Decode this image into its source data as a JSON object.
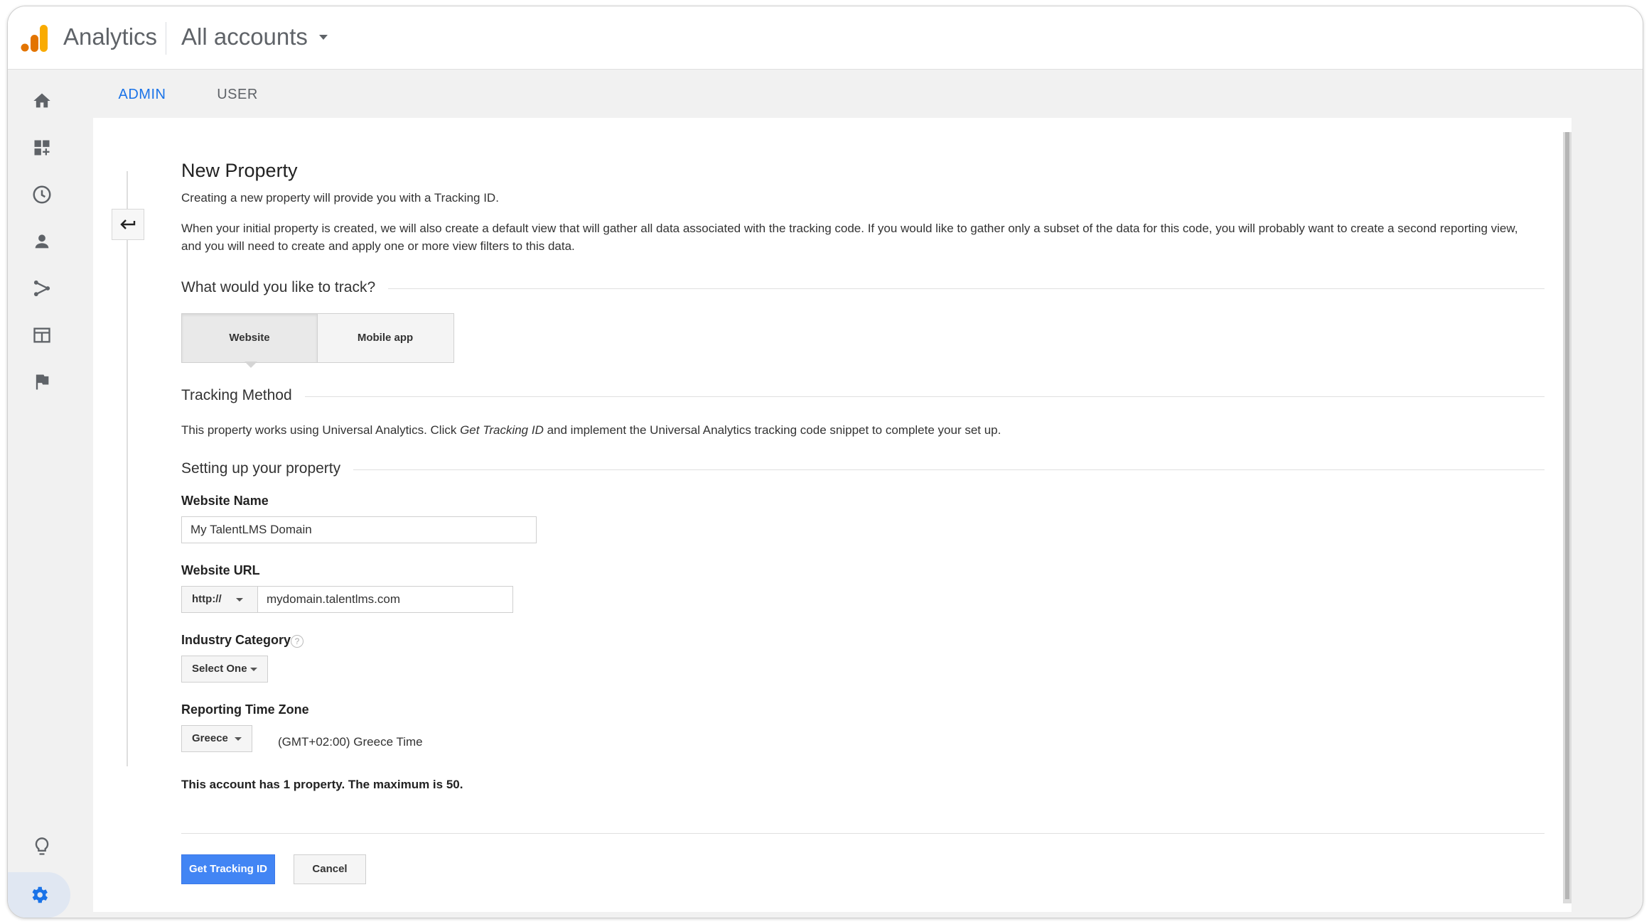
{
  "header": {
    "app_name": "Analytics",
    "account_selector": "All accounts"
  },
  "tabs": [
    {
      "label": "ADMIN",
      "active": true
    },
    {
      "label": "USER",
      "active": false
    }
  ],
  "sidenav": {
    "icons": [
      "home-icon",
      "customization-icon",
      "realtime-clock-icon",
      "audience-person-icon",
      "acquisition-icon",
      "behavior-icon",
      "conversions-flag-icon",
      "discover-lightbulb-icon",
      "admin-gear-icon"
    ]
  },
  "form": {
    "title": "New Property",
    "intro": "Creating a new property will provide you with a Tracking ID.",
    "description": "When your initial property is created, we will also create a default view that will gather all data associated with the tracking code. If you would like to gather only a subset of the data for this code, you will probably want to create a second reporting view, and you will need to create and apply one or more view filters to this data.",
    "track_question": "What would you like to track?",
    "track_options": [
      {
        "label": "Website",
        "selected": true
      },
      {
        "label": "Mobile app",
        "selected": false
      }
    ],
    "tracking_method_title": "Tracking Method",
    "tracking_method_text_1": "This property works using Universal Analytics. Click ",
    "tracking_method_link": "Get Tracking ID",
    "tracking_method_text_2": " and implement the Universal Analytics tracking code snippet to complete your set up.",
    "setup_title": "Setting up your property",
    "website_name_label": "Website Name",
    "website_name_value": "My TalentLMS Domain",
    "website_url_label": "Website URL",
    "protocol_value": "http://",
    "website_url_value": "mydomain.talentlms.com",
    "industry_label": "Industry Category",
    "industry_help": "?",
    "industry_value": "Select One",
    "timezone_label": "Reporting Time Zone",
    "timezone_country": "Greece",
    "timezone_value": "(GMT+02:00) Greece Time",
    "property_notice": "This account has 1 property. The maximum is 50.",
    "primary_button": "Get Tracking ID",
    "cancel_button": "Cancel"
  },
  "colors": {
    "accent": "#1a73e8",
    "primary_button": "#4285f4",
    "logo_orange": "#f9ab00",
    "logo_dark_orange": "#e37400"
  }
}
